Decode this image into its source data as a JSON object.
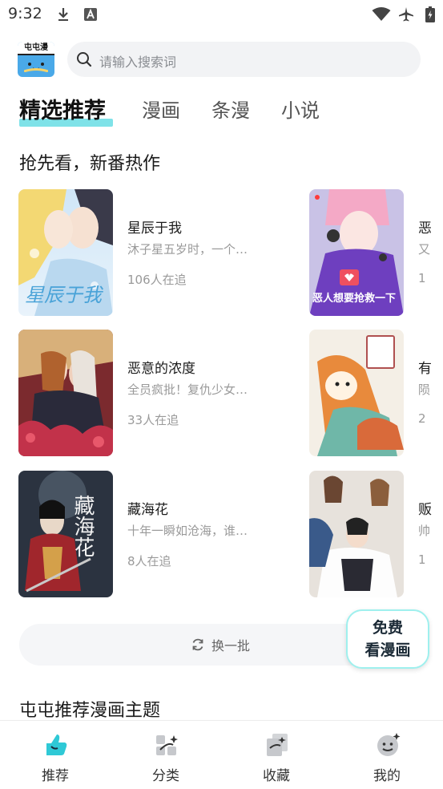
{
  "status_bar": {
    "time": "9:32",
    "icons": [
      "download-icon",
      "a-box-icon",
      "wifi-icon",
      "airplane-icon",
      "battery-icon"
    ]
  },
  "header": {
    "logo_text": "屯屯漫",
    "search_placeholder": "请输入搜索词"
  },
  "tabs": [
    {
      "label": "精选推荐",
      "active": true
    },
    {
      "label": "漫画",
      "active": false
    },
    {
      "label": "条漫",
      "active": false
    },
    {
      "label": "小说",
      "active": false
    }
  ],
  "section": {
    "title": "抢先看，新番热作"
  },
  "comics_left": [
    {
      "title": "星辰于我",
      "desc": "沐子星五岁时，一个…",
      "follow": "106人在追",
      "cover_text": "星辰于我"
    },
    {
      "title": "恶意的浓度",
      "desc": "全员疯批！复仇少女…",
      "follow": "33人在追",
      "cover_text": ""
    },
    {
      "title": "藏海花",
      "desc": "十年一瞬如沧海，谁…",
      "follow": "8人在追",
      "cover_text": "藏海花"
    }
  ],
  "comics_right": [
    {
      "title": "恶",
      "desc": "又",
      "follow": "1",
      "cover_text": "恶人想要抢救一下"
    },
    {
      "title": "有",
      "desc": "陨",
      "follow": "2",
      "cover_text": ""
    },
    {
      "title": "贩",
      "desc": "帅",
      "follow": "1",
      "cover_text": ""
    }
  ],
  "refresh": {
    "label": "换一批"
  },
  "free_badge": {
    "line1": "免费",
    "line2": "看漫画"
  },
  "recommend": {
    "title": "屯屯推荐漫画主题"
  },
  "bottom_nav": [
    {
      "label": "推荐",
      "icon": "recommend-icon",
      "active": true
    },
    {
      "label": "分类",
      "icon": "category-icon",
      "active": false
    },
    {
      "label": "收藏",
      "icon": "favorites-icon",
      "active": false
    },
    {
      "label": "我的",
      "icon": "profile-icon",
      "active": false
    }
  ],
  "colors": {
    "accent": "#7fe2e8",
    "search_bg": "#f2f3f5",
    "muted_text": "#9a9a9a",
    "nav_active": "#2fc9d6"
  }
}
